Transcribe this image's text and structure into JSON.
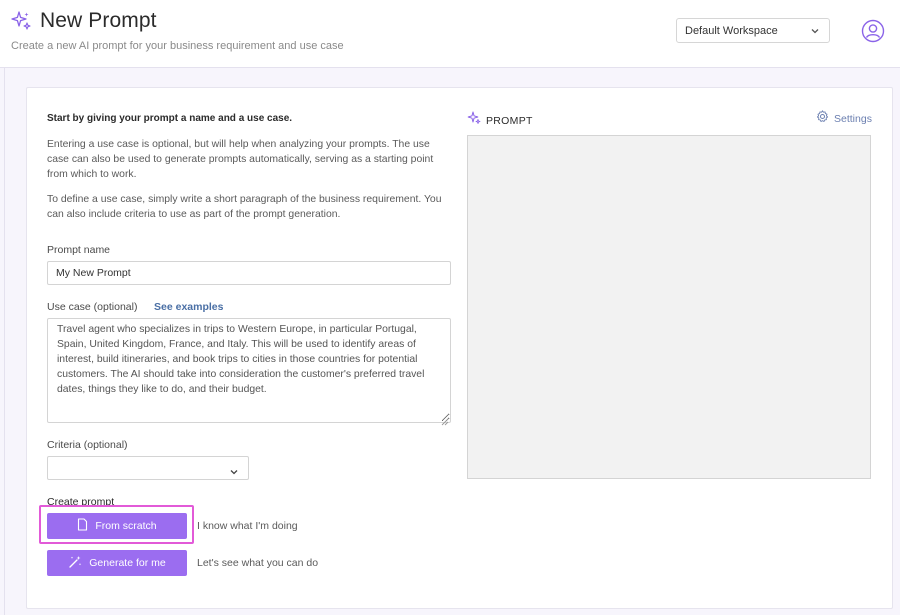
{
  "header": {
    "title": "New Prompt",
    "subtitle": "Create a new AI prompt for your business requirement and use case",
    "workspace": "Default Workspace"
  },
  "intro": {
    "heading": "Start by giving your prompt a name and a use case.",
    "paragraph1": "Entering a use case is optional, but will help when analyzing your prompts. The use case can also be used to generate prompts automatically, serving as a starting point from which to work.",
    "paragraph2": "To define a use case, simply write a short paragraph of the business requirement. You can also include criteria to use as part of the prompt generation."
  },
  "form": {
    "prompt_name_label": "Prompt name",
    "prompt_name_value": "My New Prompt",
    "use_case_label": "Use case (optional)",
    "see_examples": "See examples",
    "use_case_value": "Travel agent who specializes in trips to Western Europe, in particular Portugal, Spain, United Kingdom, France, and Italy. This will be used to identify areas of interest, build itineraries, and book trips to cities in those countries for potential customers. The AI should take into consideration the customer's preferred travel dates, things they like to do, and their budget.",
    "criteria_label": "Criteria (optional)",
    "criteria_value": "",
    "create_label": "Create prompt",
    "from_scratch_label": "From scratch",
    "from_scratch_hint": "I know what I'm doing",
    "generate_label": "Generate for me",
    "generate_hint": "Let's see what you can do"
  },
  "prompt_panel": {
    "label": "PROMPT",
    "settings_label": "Settings"
  },
  "colors": {
    "accent": "#9b6df0",
    "highlight": "#e25ad8",
    "link": "#4a6fa5",
    "background": "#f7f5fc"
  },
  "icons": {
    "title": "sparkle-icon",
    "user": "user-circle-icon",
    "prompt": "sparkle-icon",
    "settings": "gear-icon",
    "scratch": "document-icon",
    "generate": "magic-wand-icon"
  }
}
